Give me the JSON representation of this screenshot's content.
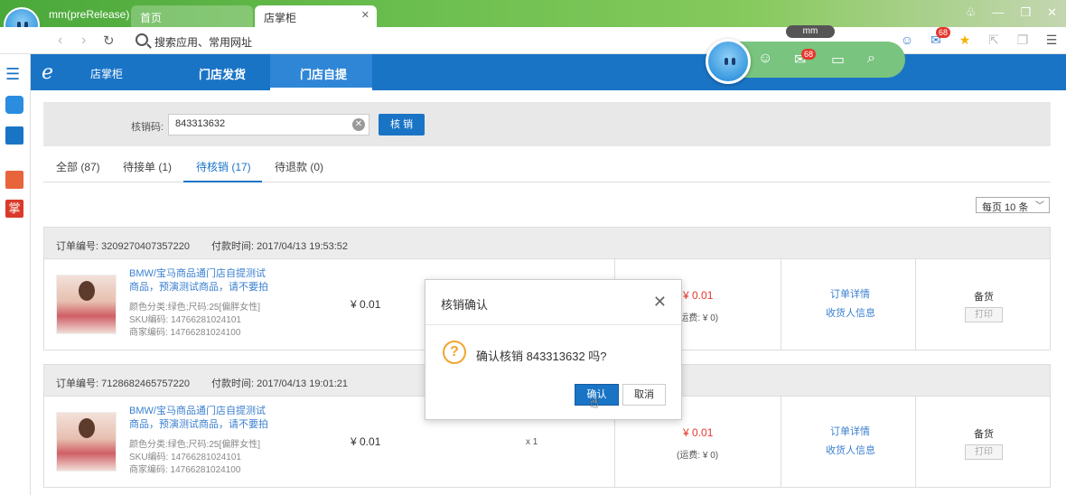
{
  "browser": {
    "app_name": "mm(preRelease)",
    "tabs": [
      {
        "label": "首页"
      },
      {
        "label": "店掌柜"
      }
    ],
    "address_placeholder": "搜索应用、常用网址",
    "mm_label": "mm",
    "mail_badge": "68",
    "pill_badge": "68"
  },
  "app": {
    "logo_text": "店掌柜",
    "nav": [
      {
        "label": "门店发货"
      },
      {
        "label": "门店自提"
      }
    ]
  },
  "filter": {
    "label": "核销码:",
    "value": "843313632",
    "button": "核 销"
  },
  "tabs": [
    {
      "label": "全部 (87)"
    },
    {
      "label": "待接单 (1)"
    },
    {
      "label": "待核销 (17)"
    },
    {
      "label": "待退款 (0)"
    }
  ],
  "page_size": "每页 10 条",
  "orders": [
    {
      "order_no": "订单编号: 3209270407357220",
      "pay_time": "付款时间: 2017/04/13 19:53:52",
      "title": "BMW/宝马商品通门店自提测试商品，预演测试商品，请不要拍",
      "attr": "颜色分类:绿色;尺码:25[偏胖女性]",
      "sku": "SKU编码: 14766281024101",
      "merchant_code": "商家编码: 14766281024100",
      "price": "¥ 0.01",
      "qty": "",
      "amount": "¥ 0.01",
      "freight": "(运费: ¥ 0)",
      "link_detail": "订单详情",
      "link_receiver": "收货人信息",
      "status": "备货",
      "print": "打印"
    },
    {
      "order_no": "订单编号: 7128682465757220",
      "pay_time": "付款时间: 2017/04/13 19:01:21",
      "title": "BMW/宝马商品通门店自提测试商品，预演测试商品，请不要拍",
      "attr": "颜色分类:绿色;尺码:25[偏胖女性]",
      "sku": "SKU编码: 14766281024101",
      "merchant_code": "商家编码: 14766281024100",
      "price": "¥ 0.01",
      "qty": "x 1",
      "amount": "¥ 0.01",
      "freight": "(运费: ¥ 0)",
      "link_detail": "订单详情",
      "link_receiver": "收货人信息",
      "status": "备货",
      "print": "打印"
    }
  ],
  "dialog": {
    "title": "核销确认",
    "message": "确认核销 843313632 吗?",
    "ok": "确认",
    "cancel": "取消"
  }
}
